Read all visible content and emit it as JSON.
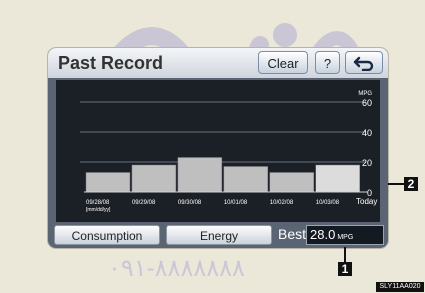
{
  "screen": {
    "title": "Past Record",
    "buttons": {
      "clear": "Clear",
      "help": "?",
      "back_icon": "return-arrow-icon"
    }
  },
  "chart_data": {
    "type": "bar",
    "categories": [
      "09/28/08",
      "09/29/08",
      "09/30/08",
      "10/01/08",
      "10/02/08",
      "10/03/08",
      "Today"
    ],
    "values": [
      13,
      18,
      23,
      17,
      13,
      18
    ],
    "y_ticks": [
      0,
      20,
      40,
      60
    ],
    "ylim": [
      0,
      60
    ],
    "y_unit": "MPG",
    "x_note": "[mm/dd/yy]",
    "grid": true,
    "colors": {
      "bars": "#bfbfbf",
      "today_bar": "#dcdcdc",
      "background": "#1b2027",
      "gridline": "#6b7280"
    }
  },
  "footer": {
    "consumption": "Consumption",
    "energy": "Energy",
    "best_label": "Best",
    "best_value": "28.0",
    "best_unit": "MPG"
  },
  "callouts": {
    "one": "1",
    "two": "2"
  },
  "image_code": "SLY11AA020",
  "watermark": "۰۹۱-۸۸۸۸۸۸۸"
}
